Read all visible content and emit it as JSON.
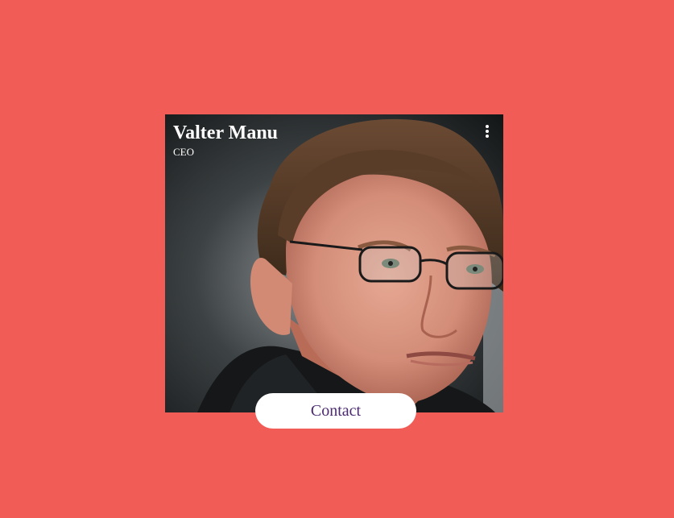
{
  "page": {
    "background_color": "#f25c57"
  },
  "profile_card": {
    "name": "Valter Manu",
    "role": "CEO",
    "photo_alt": "Portrait photo",
    "menu_icon": "more-vertical-icon"
  },
  "contact_button": {
    "label": "Contact",
    "text_color": "#4b2a6e",
    "background_color": "#ffffff"
  }
}
